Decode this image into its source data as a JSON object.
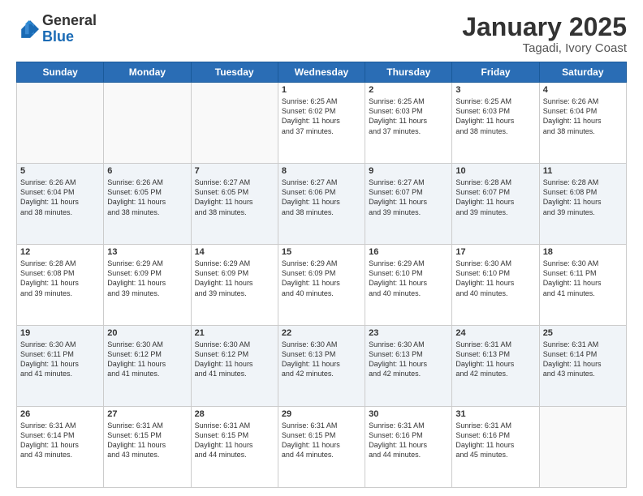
{
  "logo": {
    "general": "General",
    "blue": "Blue"
  },
  "header": {
    "month": "January 2025",
    "location": "Tagadi, Ivory Coast"
  },
  "days_of_week": [
    "Sunday",
    "Monday",
    "Tuesday",
    "Wednesday",
    "Thursday",
    "Friday",
    "Saturday"
  ],
  "weeks": [
    [
      {
        "day": "",
        "info": ""
      },
      {
        "day": "",
        "info": ""
      },
      {
        "day": "",
        "info": ""
      },
      {
        "day": "1",
        "info": "Sunrise: 6:25 AM\nSunset: 6:02 PM\nDaylight: 11 hours\nand 37 minutes."
      },
      {
        "day": "2",
        "info": "Sunrise: 6:25 AM\nSunset: 6:03 PM\nDaylight: 11 hours\nand 37 minutes."
      },
      {
        "day": "3",
        "info": "Sunrise: 6:25 AM\nSunset: 6:03 PM\nDaylight: 11 hours\nand 38 minutes."
      },
      {
        "day": "4",
        "info": "Sunrise: 6:26 AM\nSunset: 6:04 PM\nDaylight: 11 hours\nand 38 minutes."
      }
    ],
    [
      {
        "day": "5",
        "info": "Sunrise: 6:26 AM\nSunset: 6:04 PM\nDaylight: 11 hours\nand 38 minutes."
      },
      {
        "day": "6",
        "info": "Sunrise: 6:26 AM\nSunset: 6:05 PM\nDaylight: 11 hours\nand 38 minutes."
      },
      {
        "day": "7",
        "info": "Sunrise: 6:27 AM\nSunset: 6:05 PM\nDaylight: 11 hours\nand 38 minutes."
      },
      {
        "day": "8",
        "info": "Sunrise: 6:27 AM\nSunset: 6:06 PM\nDaylight: 11 hours\nand 38 minutes."
      },
      {
        "day": "9",
        "info": "Sunrise: 6:27 AM\nSunset: 6:07 PM\nDaylight: 11 hours\nand 39 minutes."
      },
      {
        "day": "10",
        "info": "Sunrise: 6:28 AM\nSunset: 6:07 PM\nDaylight: 11 hours\nand 39 minutes."
      },
      {
        "day": "11",
        "info": "Sunrise: 6:28 AM\nSunset: 6:08 PM\nDaylight: 11 hours\nand 39 minutes."
      }
    ],
    [
      {
        "day": "12",
        "info": "Sunrise: 6:28 AM\nSunset: 6:08 PM\nDaylight: 11 hours\nand 39 minutes."
      },
      {
        "day": "13",
        "info": "Sunrise: 6:29 AM\nSunset: 6:09 PM\nDaylight: 11 hours\nand 39 minutes."
      },
      {
        "day": "14",
        "info": "Sunrise: 6:29 AM\nSunset: 6:09 PM\nDaylight: 11 hours\nand 39 minutes."
      },
      {
        "day": "15",
        "info": "Sunrise: 6:29 AM\nSunset: 6:09 PM\nDaylight: 11 hours\nand 40 minutes."
      },
      {
        "day": "16",
        "info": "Sunrise: 6:29 AM\nSunset: 6:10 PM\nDaylight: 11 hours\nand 40 minutes."
      },
      {
        "day": "17",
        "info": "Sunrise: 6:30 AM\nSunset: 6:10 PM\nDaylight: 11 hours\nand 40 minutes."
      },
      {
        "day": "18",
        "info": "Sunrise: 6:30 AM\nSunset: 6:11 PM\nDaylight: 11 hours\nand 41 minutes."
      }
    ],
    [
      {
        "day": "19",
        "info": "Sunrise: 6:30 AM\nSunset: 6:11 PM\nDaylight: 11 hours\nand 41 minutes."
      },
      {
        "day": "20",
        "info": "Sunrise: 6:30 AM\nSunset: 6:12 PM\nDaylight: 11 hours\nand 41 minutes."
      },
      {
        "day": "21",
        "info": "Sunrise: 6:30 AM\nSunset: 6:12 PM\nDaylight: 11 hours\nand 41 minutes."
      },
      {
        "day": "22",
        "info": "Sunrise: 6:30 AM\nSunset: 6:13 PM\nDaylight: 11 hours\nand 42 minutes."
      },
      {
        "day": "23",
        "info": "Sunrise: 6:30 AM\nSunset: 6:13 PM\nDaylight: 11 hours\nand 42 minutes."
      },
      {
        "day": "24",
        "info": "Sunrise: 6:31 AM\nSunset: 6:13 PM\nDaylight: 11 hours\nand 42 minutes."
      },
      {
        "day": "25",
        "info": "Sunrise: 6:31 AM\nSunset: 6:14 PM\nDaylight: 11 hours\nand 43 minutes."
      }
    ],
    [
      {
        "day": "26",
        "info": "Sunrise: 6:31 AM\nSunset: 6:14 PM\nDaylight: 11 hours\nand 43 minutes."
      },
      {
        "day": "27",
        "info": "Sunrise: 6:31 AM\nSunset: 6:15 PM\nDaylight: 11 hours\nand 43 minutes."
      },
      {
        "day": "28",
        "info": "Sunrise: 6:31 AM\nSunset: 6:15 PM\nDaylight: 11 hours\nand 44 minutes."
      },
      {
        "day": "29",
        "info": "Sunrise: 6:31 AM\nSunset: 6:15 PM\nDaylight: 11 hours\nand 44 minutes."
      },
      {
        "day": "30",
        "info": "Sunrise: 6:31 AM\nSunset: 6:16 PM\nDaylight: 11 hours\nand 44 minutes."
      },
      {
        "day": "31",
        "info": "Sunrise: 6:31 AM\nSunset: 6:16 PM\nDaylight: 11 hours\nand 45 minutes."
      },
      {
        "day": "",
        "info": ""
      }
    ]
  ]
}
